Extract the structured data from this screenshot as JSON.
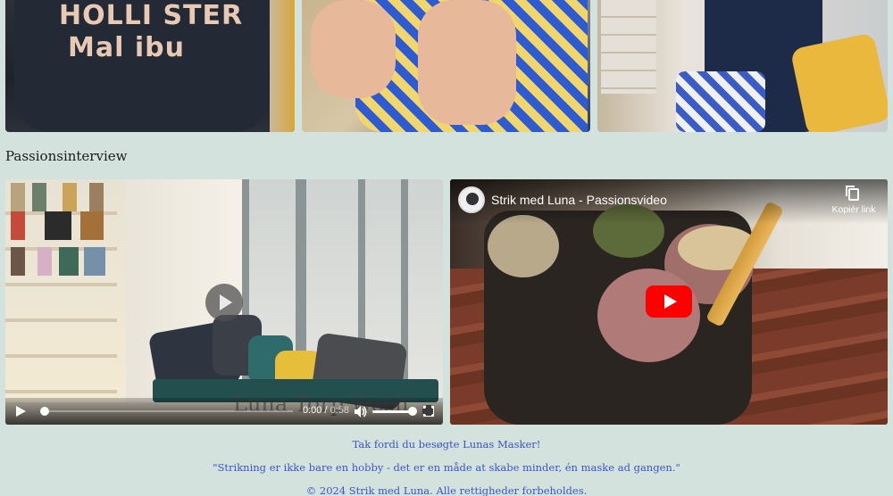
{
  "photos": {
    "photo1_print_top": "HOLLI STER",
    "photo1_print_bottom": "Mal ibu"
  },
  "section": {
    "title": "Passionsinterview"
  },
  "video_local": {
    "overlay_text": "Luna Torp Wesh",
    "current_time": "0:00",
    "duration": "0:58",
    "progress": 0,
    "volume": 0.9
  },
  "video_youtube": {
    "title": "Strik med Luna - Passionsvideo",
    "copy_link_label": "Kopiér link"
  },
  "footer": {
    "thanks": "Tak fordi du besøgte Lunas Masker!",
    "quote": "\"Strikning er ikke bare en hobby - det er en måde at skabe minder, én maske ad gangen.\"",
    "copyright": "© 2024 Strik med Luna. Alle rettigheder forbeholdes."
  },
  "colors": {
    "background": "#d3e2dc",
    "footer_text": "#3d55c4",
    "youtube_red": "#ff0000"
  }
}
